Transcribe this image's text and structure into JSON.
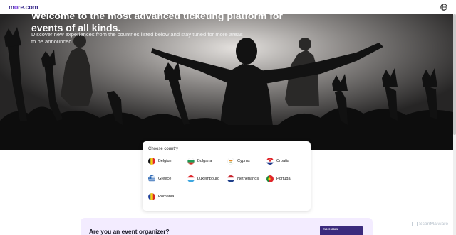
{
  "header": {
    "logo_part1": "m",
    "logo_accent": "o",
    "logo_part2": "re.com",
    "globe_icon": "globe-icon"
  },
  "hero": {
    "title": "Welcome to the most advanced ticketing platform for events of all kinds.",
    "subtitle": "Discover new experiences from the countries listed below and stay tuned for more areas to be announced."
  },
  "country_picker": {
    "title": "Choose country",
    "countries": [
      {
        "name": "Belgium",
        "flag": "belgium-flag-icon"
      },
      {
        "name": "Bulgaria",
        "flag": "bulgaria-flag-icon"
      },
      {
        "name": "Cyprus",
        "flag": "cyprus-flag-icon"
      },
      {
        "name": "Croatia",
        "flag": "croatia-flag-icon"
      },
      {
        "name": "Greece",
        "flag": "greece-flag-icon"
      },
      {
        "name": "Luxembourg",
        "flag": "luxembourg-flag-icon"
      },
      {
        "name": "Netherlands",
        "flag": "netherlands-flag-icon"
      },
      {
        "name": "Portugal",
        "flag": "portugal-flag-icon"
      },
      {
        "name": "Romania",
        "flag": "romania-flag-icon"
      }
    ]
  },
  "organizer": {
    "heading": "Are you an event organizer?",
    "image_logo": "more.com"
  },
  "watermark": {
    "text": "ScanMalware"
  },
  "colors": {
    "brand": "#3a2a8c",
    "brand_accent": "#7b3fe4",
    "organizer_bg": "#f3ecff"
  }
}
